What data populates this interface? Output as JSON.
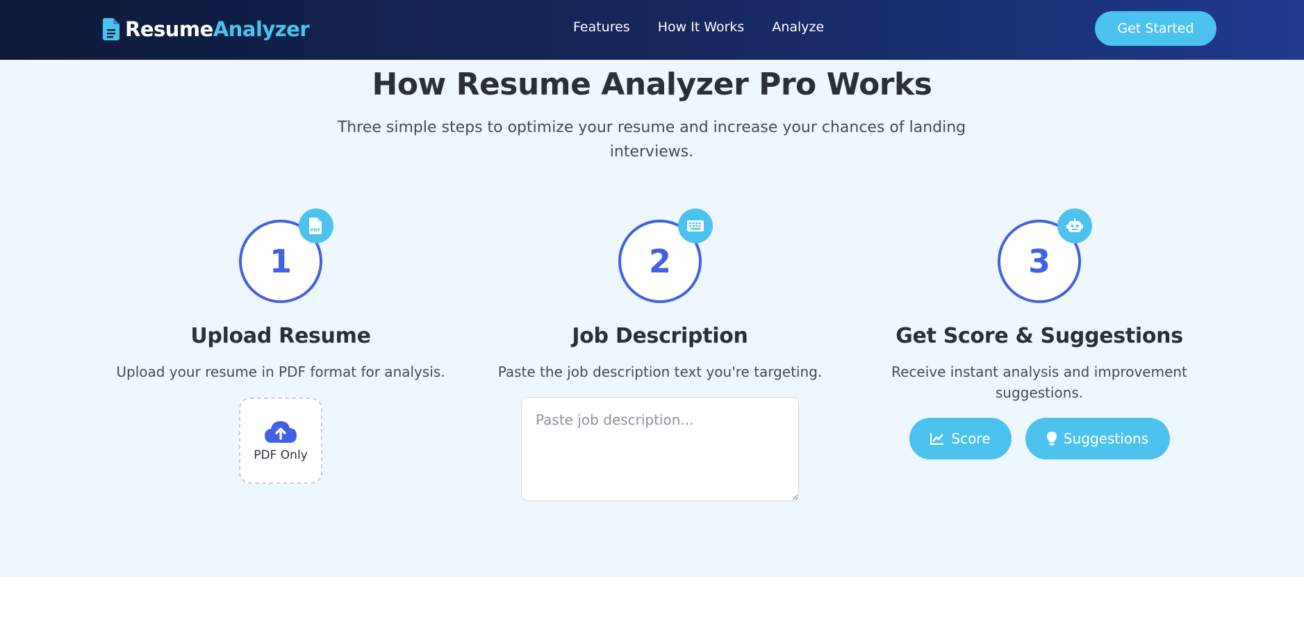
{
  "brand": {
    "name_part1": "Resume",
    "name_part2": "Analyzer"
  },
  "nav": {
    "links": [
      "Features",
      "How It Works",
      "Analyze"
    ],
    "cta": "Get Started"
  },
  "section": {
    "title": "How Resume Analyzer Pro Works",
    "subtitle": "Three simple steps to optimize your resume and increase your chances of landing interviews."
  },
  "steps": [
    {
      "number": "1",
      "icon": "pdf-file-icon",
      "title": "Upload Resume",
      "description": "Upload your resume in PDF format for analysis.",
      "upload_label": "PDF Only"
    },
    {
      "number": "2",
      "icon": "keyboard-icon",
      "title": "Job Description",
      "description": "Paste the job description text you're targeting.",
      "textarea_placeholder": "Paste job description..."
    },
    {
      "number": "3",
      "icon": "robot-icon",
      "title": "Get Score & Suggestions",
      "description": "Receive instant analysis and improvement suggestions.",
      "buttons": [
        "Score",
        "Suggestions"
      ]
    }
  ],
  "colors": {
    "accent": "#4cc3ee",
    "primary": "#4161e3",
    "navy": "#0e1a3a",
    "section_bg": "#eef6fe"
  }
}
